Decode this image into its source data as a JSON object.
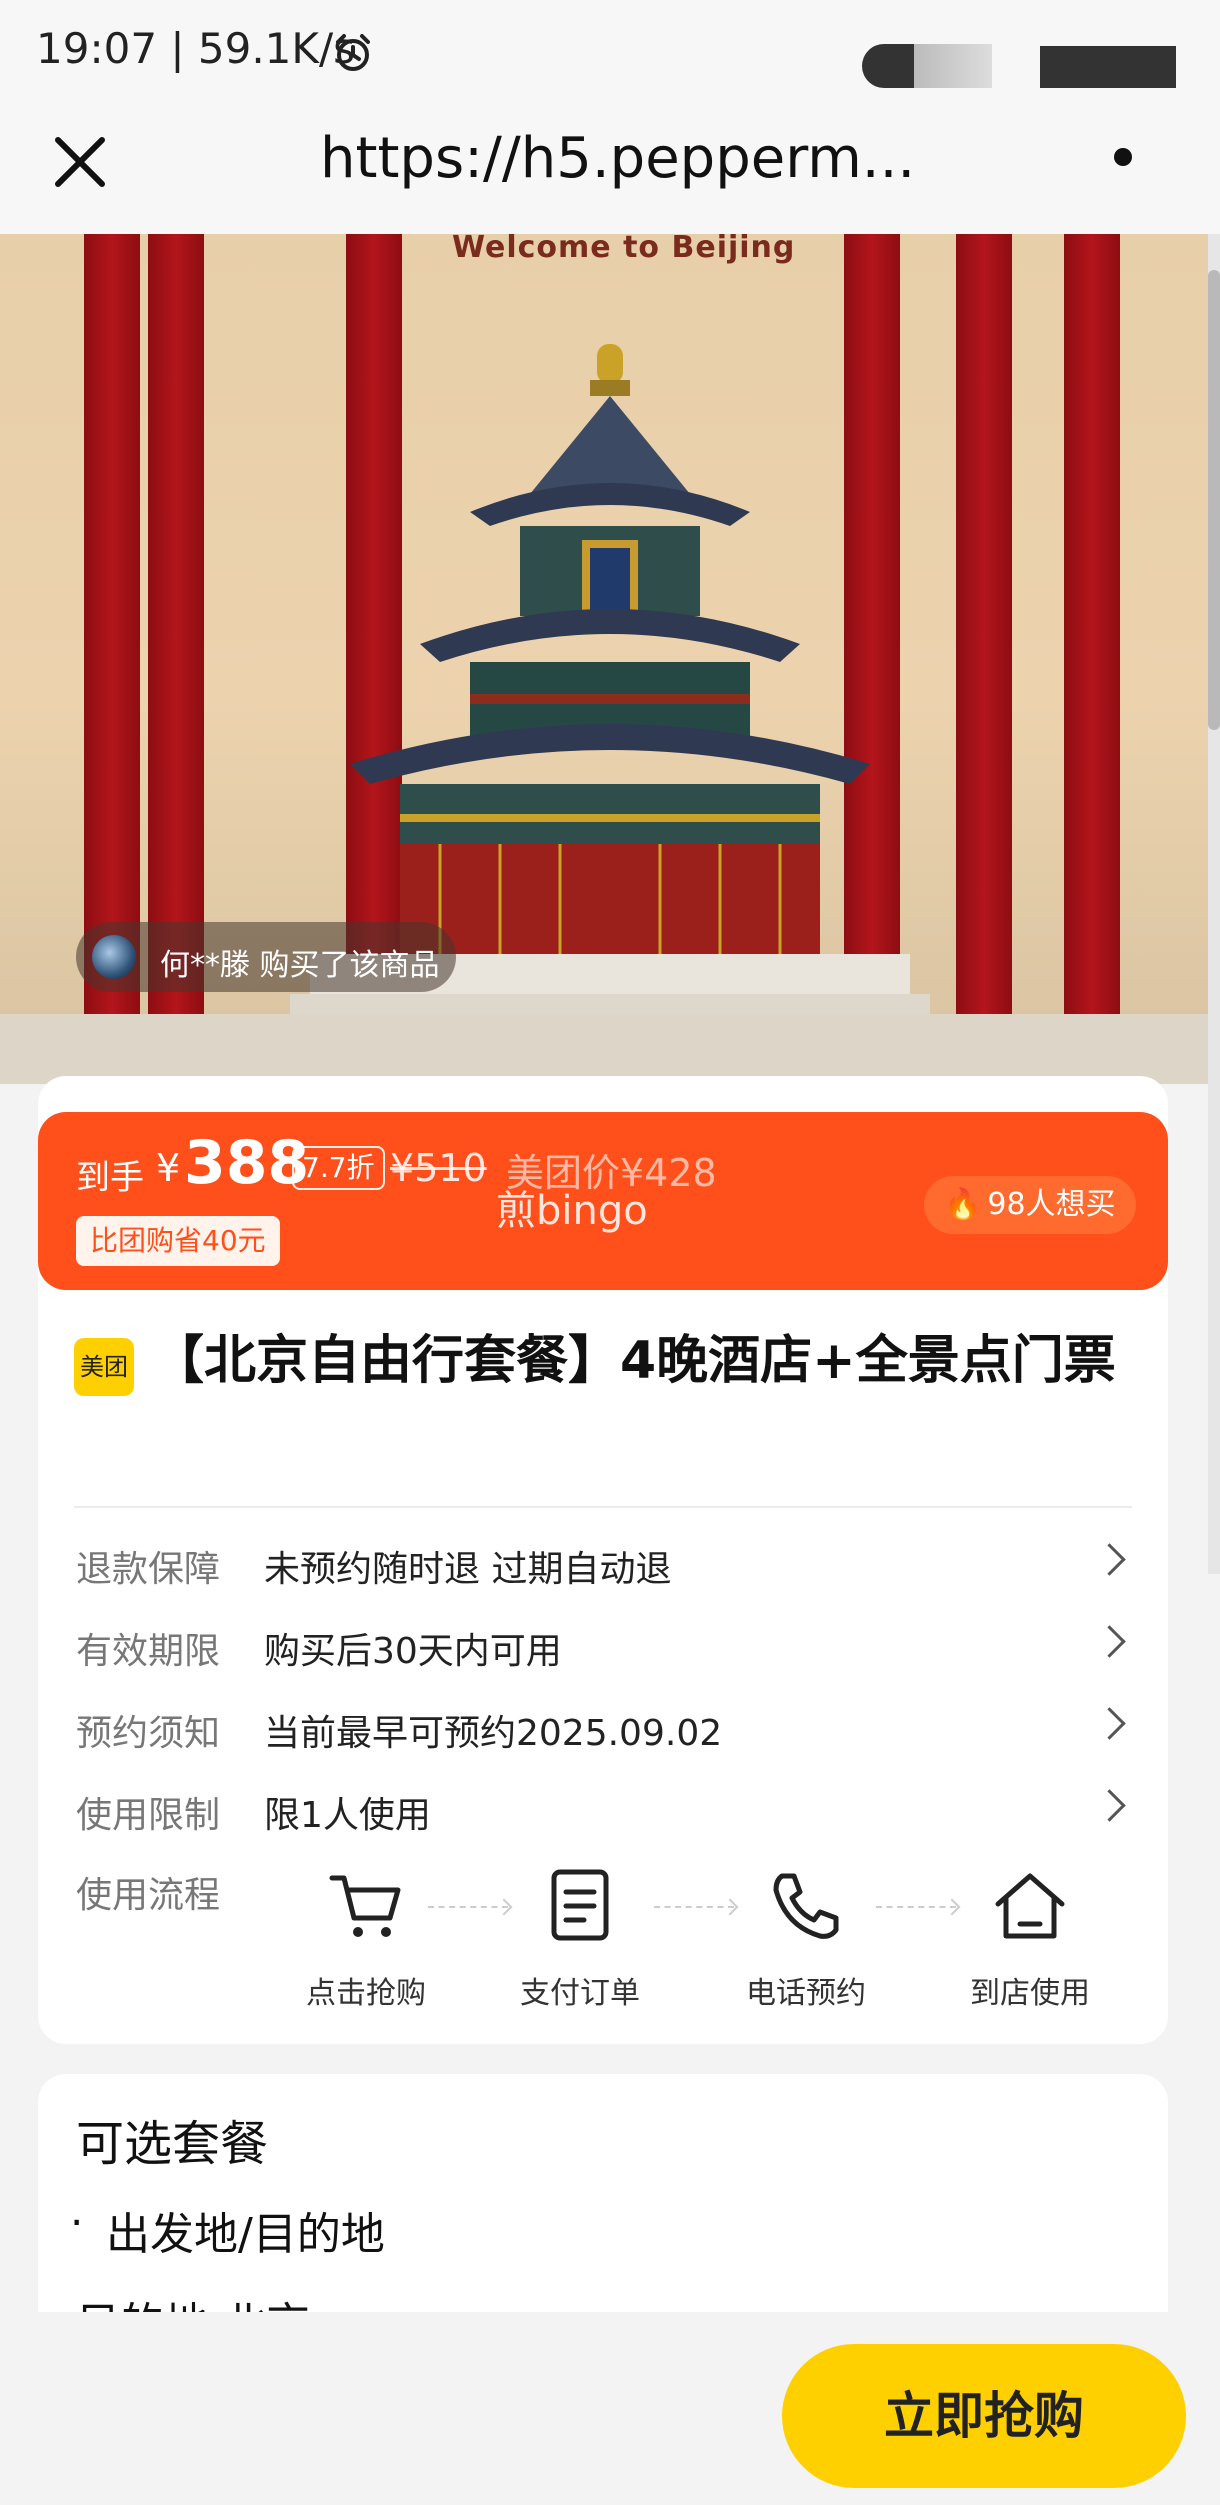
{
  "status_bar": {
    "time": "19:07 | 59.1K/s"
  },
  "browser": {
    "url": "https://h5.pepperm..."
  },
  "hero": {
    "banner_text": "Welcome to Beijing",
    "recent_purchase": "何**滕 购买了该商品"
  },
  "price": {
    "label": "到手",
    "currency": "¥",
    "amount": "388",
    "discount": "7.7折",
    "original": "¥510",
    "meituan_price": "美团价¥428",
    "watermark": "煎bingo",
    "savings": "比团购省40元",
    "want_count": "98人想买"
  },
  "product": {
    "brand_badge": "美团",
    "title": "【北京自由行套餐】4晚酒店+全景点门票"
  },
  "info_rows": [
    {
      "label": "退款保障",
      "value": "未预约随时退 过期自动退"
    },
    {
      "label": "有效期限",
      "value": "购买后30天内可用"
    },
    {
      "label": "预约须知",
      "value": "当前最早可预约2025.09.02"
    },
    {
      "label": "使用限制",
      "value": "限1人使用"
    }
  ],
  "flow": {
    "label": "使用流程",
    "steps": [
      {
        "label": "点击抢购",
        "icon": "cart-icon"
      },
      {
        "label": "支付订单",
        "icon": "document-icon"
      },
      {
        "label": "电话预约",
        "icon": "phone-icon"
      },
      {
        "label": "到店使用",
        "icon": "home-icon"
      }
    ]
  },
  "options": {
    "title": "可选套餐",
    "bullet": "·",
    "line1": "出发地/目的地",
    "line2": "目的地 北京"
  },
  "cta": {
    "label": "立即抢购"
  },
  "colors": {
    "accent": "#ff4f1a",
    "cta": "#ffd000",
    "temple_red": "#b3151b"
  }
}
